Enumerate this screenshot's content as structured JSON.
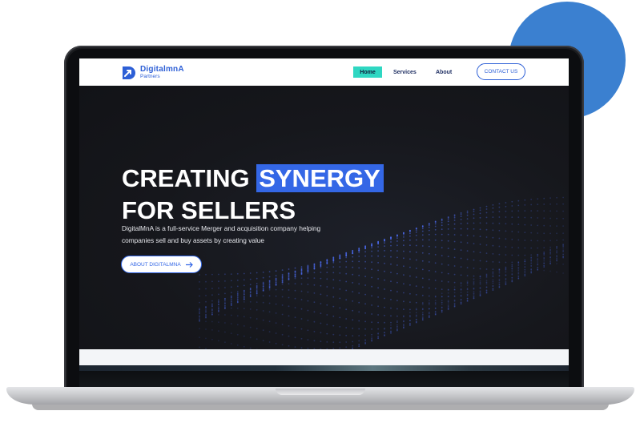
{
  "logo": {
    "name": "DigitalmnA",
    "tagline": "Partners",
    "icon": "arrow-d-logo-icon"
  },
  "nav": {
    "home": "Home",
    "services": "Services",
    "about": "About",
    "contact": "CONTACT US"
  },
  "hero": {
    "title_line1_prefix": "CREATING ",
    "title_line1_highlight": "SYNERGY",
    "title_line2": "FOR SELLERS",
    "subtitle_line1": "DigitalMnA is a full-service Merger and acquisition company helping",
    "subtitle_line2": "companies sell and buy assets by creating value",
    "cta_label": "ABOUT DIGITALMNA",
    "cta_icon": "arrow-right-icon"
  },
  "colors": {
    "accent": "#3467e6",
    "nav_active": "#2fd7c2",
    "decor_circle": "#3b80d0",
    "hero_bg": "#16171b"
  }
}
